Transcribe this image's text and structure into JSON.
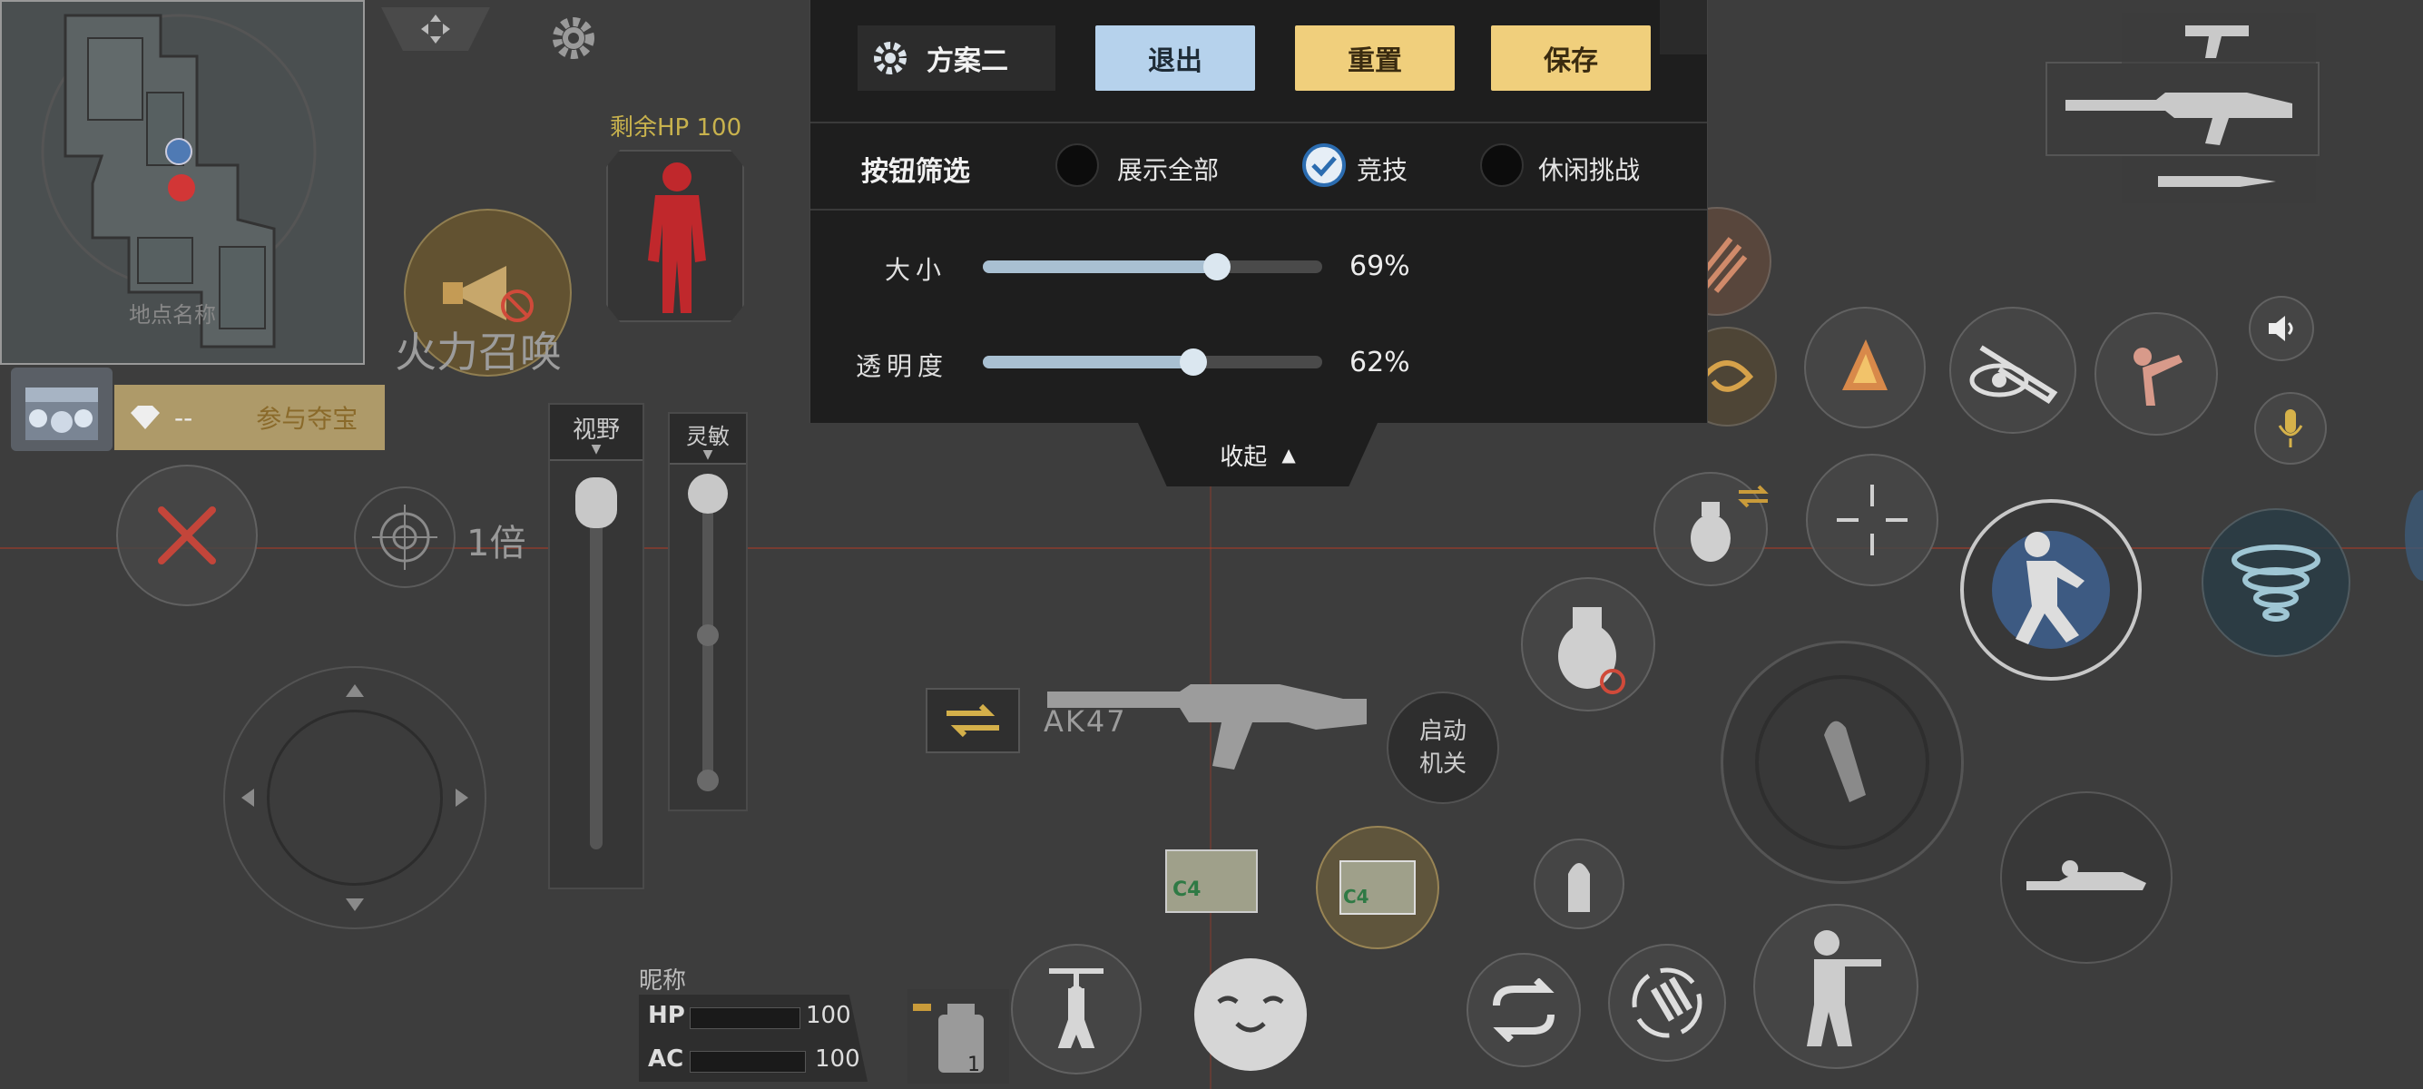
{
  "panel": {
    "scheme_name": "方案二",
    "exit_label": "退出",
    "reset_label": "重置",
    "save_label": "保存",
    "filter_label": "按钮筛选",
    "filters": [
      {
        "label": "展示全部",
        "checked": false
      },
      {
        "label": "竞技",
        "checked": true
      },
      {
        "label": "休闲挑战",
        "checked": false
      }
    ],
    "size_label": "大小",
    "size_value": "69%",
    "size_fraction": 0.69,
    "opacity_label": "透明度",
    "opacity_value": "62%",
    "opacity_fraction": 0.62,
    "collapse_label": "收起"
  },
  "minimap": {
    "place_name": "地点名称"
  },
  "hp_figure": {
    "label": "剩余HP 100"
  },
  "firepower": {
    "label": "火力召唤"
  },
  "treasure": {
    "dashes": "--",
    "join_label": "参与夺宝"
  },
  "scope": {
    "label": "1倍"
  },
  "sliders": {
    "view_label": "视野",
    "sensitivity_label": "灵敏"
  },
  "weapon": {
    "name": "AK47"
  },
  "switch_btn": {
    "label": "启动\n机关"
  },
  "player": {
    "nickname": "昵称",
    "hp_label": "HP",
    "hp_value": "100",
    "ac_label": "AC",
    "ac_value": "100"
  },
  "c4_label": "C4",
  "colors": {
    "accent_blue": "#b6d2ec",
    "accent_gold": "#f0cf7c",
    "panel_bg": "#1e1e1e",
    "hp_red": "#c0282c"
  }
}
